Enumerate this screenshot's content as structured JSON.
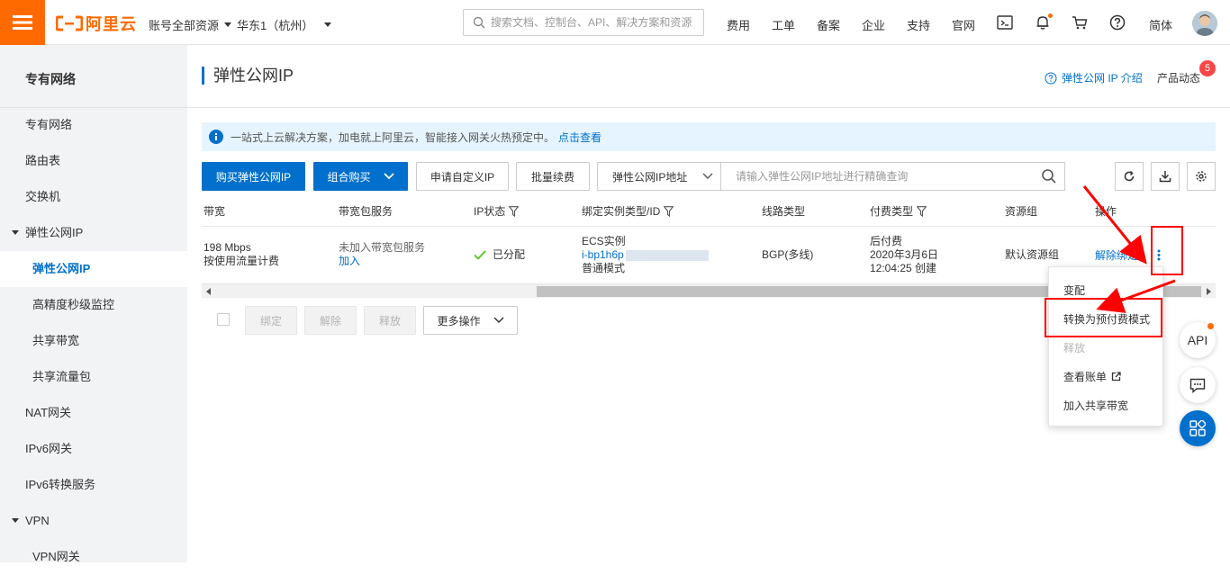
{
  "brand": {
    "name": "阿里云",
    "color": "#ff6a00"
  },
  "topbar": {
    "account_scope": "账号全部资源",
    "region": "华东1（杭州）",
    "search_placeholder": "搜索文档、控制台、API、解决方案和资源",
    "nav": [
      "费用",
      "工单",
      "备案",
      "企业",
      "支持",
      "官网"
    ],
    "language": "简体",
    "icons": [
      "terminal-icon",
      "bell-icon",
      "cart-icon",
      "help-icon"
    ]
  },
  "sidebar": {
    "title": "专有网络",
    "items": [
      {
        "label": "专有网络"
      },
      {
        "label": "路由表"
      },
      {
        "label": "交换机"
      },
      {
        "label": "弹性公网IP"
      },
      {
        "label": "弹性公网IP"
      },
      {
        "label": "高精度秒级监控"
      },
      {
        "label": "共享带宽"
      },
      {
        "label": "共享流量包"
      },
      {
        "label": "NAT网关"
      },
      {
        "label": "IPv6网关"
      },
      {
        "label": "IPv6转换服务"
      },
      {
        "label": "VPN"
      },
      {
        "label": "VPN网关"
      }
    ]
  },
  "main": {
    "title": "弹性公网IP",
    "help_link": "弹性公网 IP 介绍",
    "product_news": "产品动态",
    "news_count": "5",
    "notice": {
      "text": "一站式上云解决方案，加电就上阿里云，智能接入网关火热预定中。",
      "link": "点击查看"
    },
    "toolbar": {
      "buy": "购买弹性公网IP",
      "combo": "组合购买",
      "apply_custom": "申请自定义IP",
      "batch_renew": "批量续费",
      "filter_type": "弹性公网IP地址",
      "filter_placeholder": "请输入弹性公网IP地址进行精确查询"
    },
    "table": {
      "columns": [
        "带宽",
        "带宽包服务",
        "IP状态",
        "绑定实例类型/ID",
        "线路类型",
        "付费类型",
        "资源组",
        "操作"
      ],
      "row": {
        "bandwidth": "198 Mbps",
        "billing_mode": "按使用流量计费",
        "pkg_status": "未加入带宽包服务",
        "pkg_add": "加入",
        "ip_status": "已分配",
        "instance_type": "ECS实例",
        "instance_id": "i-bp1h6p",
        "instance_mode": "普通模式",
        "line": "BGP(多线)",
        "pay_type": "后付费",
        "pay_date": "2020年3月6日",
        "pay_time": "12:04:25 创建",
        "resource_group": "默认资源组",
        "action_unbind": "解除绑定"
      }
    },
    "bottom_actions": {
      "bind": "绑定",
      "unbind": "解除",
      "release": "释放",
      "more": "更多操作"
    },
    "dropdown": [
      "变配",
      "转换为预付费模式",
      "释放",
      "查看账单",
      "加入共享带宽"
    ],
    "float": {
      "api": "API"
    }
  },
  "colors": {
    "accent": "#0070cc",
    "highlight": "#ff0000",
    "success": "#52c41a"
  }
}
